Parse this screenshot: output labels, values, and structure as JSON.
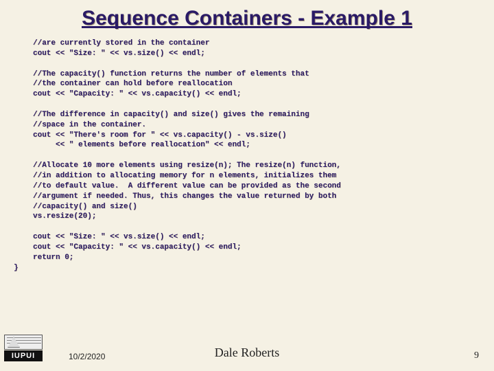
{
  "title": "Sequence Containers - Example 1",
  "code": "//are currently stored in the container\ncout << \"Size: \" << vs.size() << endl;\n\n//The capacity() function returns the number of elements that\n//the container can hold before reallocation\ncout << \"Capacity: \" << vs.capacity() << endl;\n\n//The difference in capacity() and size() gives the remaining\n//space in the container.\ncout << \"There's room for \" << vs.capacity() - vs.size()\n     << \" elements before reallocation\" << endl;\n\n//Allocate 10 more elements using resize(n); The resize(n) function,\n//in addition to allocating memory for n elements, initializes them\n//to default value.  A different value can be provided as the second\n//argument if needed. Thus, this changes the value returned by both\n//capacity() and size()\nvs.resize(20);\n\ncout << \"Size: \" << vs.size() << endl;\ncout << \"Capacity: \" << vs.capacity() << endl;\nreturn 0;",
  "closing_brace": "}",
  "footer": {
    "date": "10/2/2020",
    "author": "Dale Roberts",
    "page": "9",
    "logo_text": "IUPUI"
  }
}
